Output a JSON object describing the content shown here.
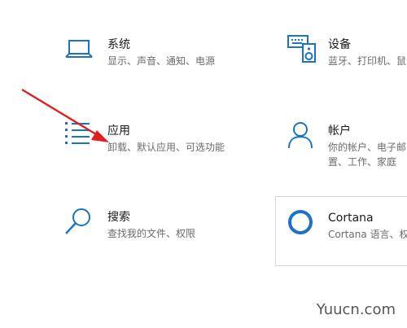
{
  "accent_color": "#1a73c8",
  "settings": {
    "system": {
      "title": "系统",
      "desc": "显示、声音、通知、电源",
      "icon": "laptop-icon"
    },
    "devices": {
      "title": "设备",
      "desc": "蓝牙、打印机、鼠",
      "icon": "keyboard-speaker-icon"
    },
    "apps": {
      "title": "应用",
      "desc": "卸载、默认应用、可选功能",
      "icon": "app-list-icon"
    },
    "accounts": {
      "title": "帐户",
      "desc1": "你的帐户、电子邮",
      "desc2": "置、工作、家庭",
      "icon": "person-icon"
    },
    "search": {
      "title": "搜索",
      "desc": "查找我的文件、权限",
      "icon": "magnifier-icon"
    },
    "cortana": {
      "title": "Cortana",
      "desc": "Cortana 语言、权",
      "icon": "cortana-ring-icon"
    }
  },
  "annotation": {
    "arrow_color": "#e02020"
  },
  "watermark": "Yuucn.com"
}
